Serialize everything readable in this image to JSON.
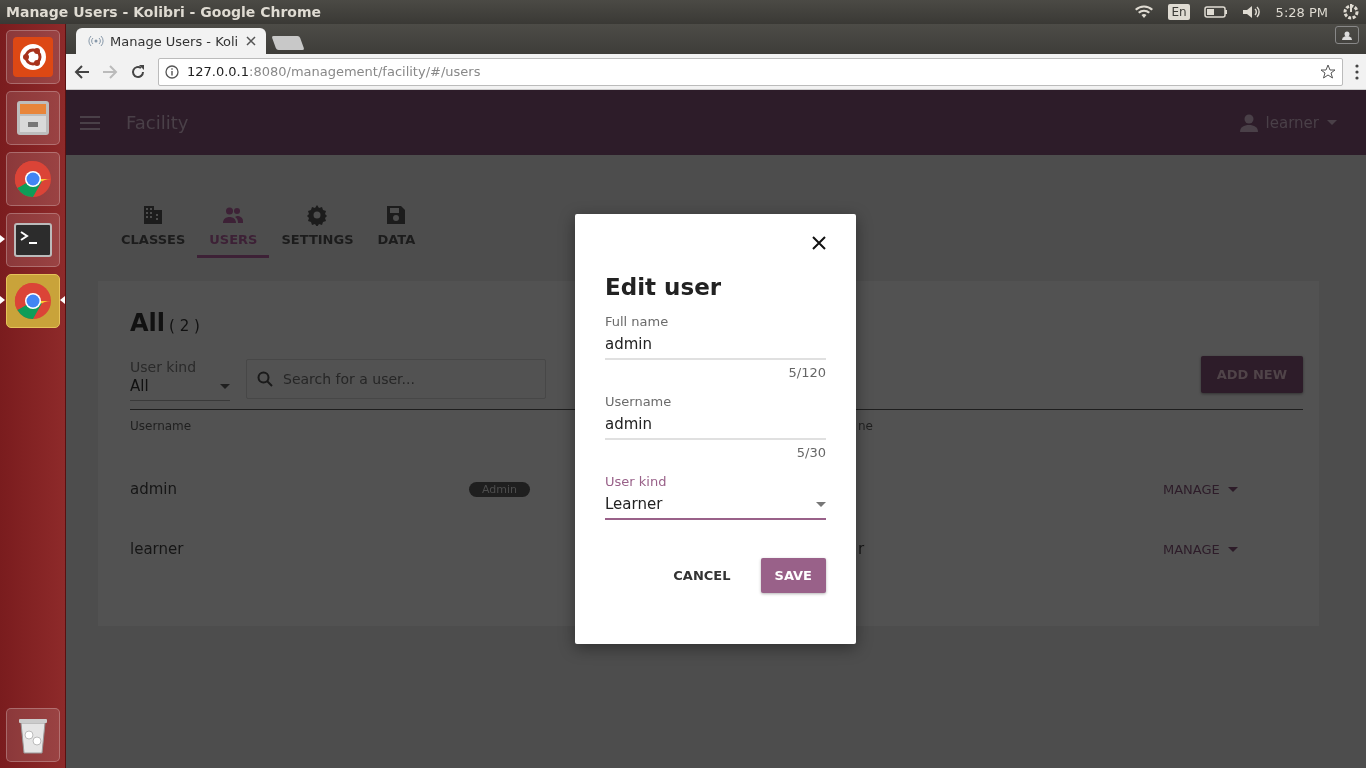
{
  "system_bar": {
    "window_title": "Manage Users - Kolibri - Google Chrome",
    "keyboard": "En",
    "clock": "5:28 PM"
  },
  "launcher": {
    "items": [
      {
        "kind": "ubuntu",
        "running": false,
        "focused": false
      },
      {
        "kind": "files",
        "running": false,
        "focused": false
      },
      {
        "kind": "chrome",
        "running": false,
        "focused": false
      },
      {
        "kind": "terminal",
        "running": true,
        "focused": false
      },
      {
        "kind": "chrome",
        "running": true,
        "focused": true
      },
      {
        "kind": "trash",
        "running": false,
        "focused": false
      }
    ]
  },
  "browser": {
    "tab_title": "Manage Users - Koli",
    "url_host": "127.0.0.1",
    "url_path": ":8080/management/facility/#/users"
  },
  "app_bar": {
    "title": "Facility",
    "user": "learner"
  },
  "nav_tabs": [
    {
      "label": "CLASSES",
      "kind": "building",
      "selected": false
    },
    {
      "label": "USERS",
      "kind": "people",
      "selected": true
    },
    {
      "label": "SETTINGS",
      "kind": "gear",
      "selected": false
    },
    {
      "label": "DATA",
      "kind": "disk",
      "selected": false
    }
  ],
  "users": {
    "heading": "All",
    "count": "( 2 )",
    "filter": {
      "label": "User kind",
      "value": "All"
    },
    "search": {
      "placeholder": "Search for a user..."
    },
    "add_button": "ADD NEW",
    "columns": [
      "Username",
      "ne"
    ],
    "rows": [
      {
        "username": "admin",
        "badge": "Admin",
        "action": "MANAGE"
      },
      {
        "username": "learner",
        "column_2": "r",
        "action": "MANAGE"
      }
    ]
  },
  "dialog": {
    "title": "Edit user",
    "fields": [
      {
        "kind": "text",
        "label": "Full name",
        "value": "admin",
        "counter": "5/120",
        "focused": false
      },
      {
        "kind": "text",
        "label": "Username",
        "value": "admin",
        "counter": "5/30",
        "focused": false
      },
      {
        "kind": "select",
        "label": "User kind",
        "value": "Learner",
        "focused": true
      }
    ],
    "buttons": [
      {
        "label": "CANCEL",
        "primary": false
      },
      {
        "label": "SAVE",
        "primary": true
      }
    ]
  }
}
